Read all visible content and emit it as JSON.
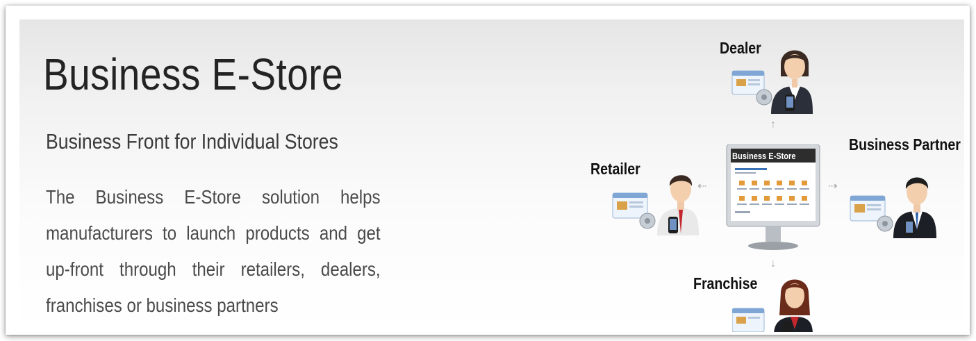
{
  "heading": {
    "title": "Business E-Store",
    "subtitle": "Business Front for Individual Stores",
    "description": "The Business E-Store solution helps manufacturers to launch products and get up-front through their retailers, dealers, franchises or business partners"
  },
  "diagram": {
    "center_screen_title": "Business E-Store",
    "roles": {
      "dealer": "Dealer",
      "retailer": "Retailer",
      "business_partner": "Business Partner",
      "franchise": "Franchise"
    }
  },
  "colors": {
    "title_text": "#232323",
    "body_text": "#4a4a4a",
    "monitor_header": "#2d2d2d",
    "accent_blue": "#3a72b8"
  }
}
